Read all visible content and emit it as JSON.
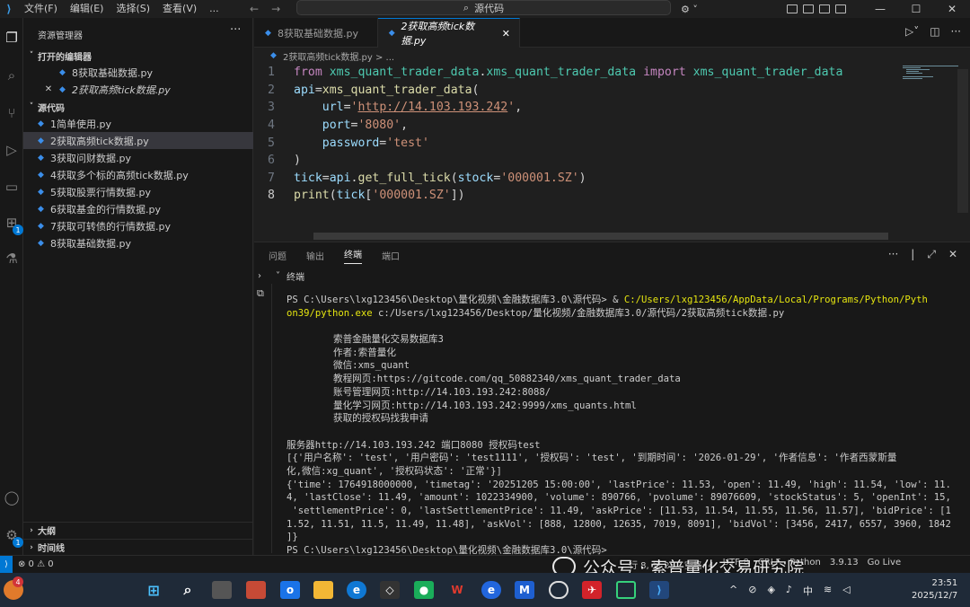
{
  "menu": {
    "items": [
      "文件(F)",
      "编辑(E)",
      "选择(S)",
      "查看(V)",
      "..."
    ]
  },
  "search": {
    "label": "源代码"
  },
  "sidebar": {
    "title": "资源管理器",
    "open_editors_title": "打开的编辑器",
    "open_editors": [
      "8获取基础数据.py",
      "2获取高频tick数据.py"
    ],
    "folder_title": "源代码",
    "files": [
      "1简单使用.py",
      "2获取高频tick数据.py",
      "3获取问财数据.py",
      "4获取多个标的高频tick数据.py",
      "5获取股票行情数据.py",
      "6获取基金的行情数据.py",
      "7获取可转债的行情数据.py",
      "8获取基础数据.py"
    ],
    "outline": "大纲",
    "timeline": "时间线",
    "activity_badge": "1",
    "settings_badge": "1"
  },
  "tabs": [
    {
      "label": "8获取基础数据.py"
    },
    {
      "label": "2获取高频tick数据.py"
    }
  ],
  "breadcrumb": "2获取高频tick数据.py > ...",
  "editor": {
    "line_numbers": [
      "1",
      "2",
      "3",
      "4",
      "5",
      "6",
      "7",
      "8"
    ],
    "lines": [
      [
        [
          "kw",
          "from "
        ],
        [
          "mod",
          "xms_quant_trader_data"
        ],
        [
          "code",
          "."
        ],
        [
          "mod",
          "xms_quant_trader_data"
        ],
        [
          "kw",
          " import "
        ],
        [
          "mod",
          "xms_quant_trader_data"
        ]
      ],
      [
        [
          "var",
          "api"
        ],
        [
          "code",
          "="
        ],
        [
          "fn",
          "xms_quant_trader_data"
        ],
        [
          "code",
          "("
        ]
      ],
      [
        [
          "code",
          "    "
        ],
        [
          "var",
          "url"
        ],
        [
          "code",
          "="
        ],
        [
          "str",
          "'"
        ],
        [
          "url",
          "http://14.103.193.242"
        ],
        [
          "str",
          "'"
        ],
        [
          "code",
          ","
        ]
      ],
      [
        [
          "code",
          "    "
        ],
        [
          "var",
          "port"
        ],
        [
          "code",
          "="
        ],
        [
          "str",
          "'8080'"
        ],
        [
          "code",
          ","
        ]
      ],
      [
        [
          "code",
          "    "
        ],
        [
          "var",
          "password"
        ],
        [
          "code",
          "="
        ],
        [
          "str",
          "'test'"
        ]
      ],
      [
        [
          "code",
          ")"
        ]
      ],
      [
        [
          "var",
          "tick"
        ],
        [
          "code",
          "="
        ],
        [
          "var",
          "api"
        ],
        [
          "code",
          "."
        ],
        [
          "fn",
          "get_full_tick"
        ],
        [
          "code",
          "("
        ],
        [
          "var",
          "stock"
        ],
        [
          "code",
          "="
        ],
        [
          "str",
          "'000001.SZ'"
        ],
        [
          "code",
          ")"
        ]
      ],
      [
        [
          "fn",
          "print"
        ],
        [
          "code",
          "("
        ],
        [
          "var",
          "tick"
        ],
        [
          "code",
          "["
        ],
        [
          "str",
          "'000001.SZ'"
        ],
        [
          "code",
          "])"
        ]
      ]
    ]
  },
  "panel": {
    "tabs": [
      "问题",
      "输出",
      "终端",
      "端口"
    ],
    "terminal_label": "终端",
    "lines": [
      {
        "t": "PS C:\\Users\\lxg123456\\Desktop\\量化视频\\金融数据库3.0\\源代码> & ",
        "y": "C:/Users/lxg123456/AppData/Local/Programs/Python/Pyth"
      },
      {
        "t": "",
        "y": "on39/python.exe",
        "t2": " c:/Users/lxg123456/Desktop/量化视频/金融数据库3.0/源代码/2获取高频tick数据.py"
      },
      {
        "t": ""
      },
      {
        "t": "索普金融量化交易数据库3",
        "i": true
      },
      {
        "t": "作者:索普量化",
        "i": true
      },
      {
        "t": "微信:xms_quant",
        "i": true
      },
      {
        "t": "教程网页:https://gitcode.com/qq_50882340/xms_quant_trader_data",
        "i": true
      },
      {
        "t": "账号管理网页:http://14.103.193.242:8088/",
        "i": true
      },
      {
        "t": "量化学习网页:http://14.103.193.242:9999/xms_quants.html",
        "i": true
      },
      {
        "t": "获取的授权码找我申请",
        "i": true
      },
      {
        "t": ""
      },
      {
        "t": "服务器http://14.103.193.242 端口8080 授权码test"
      },
      {
        "t": "[{'用户名称': 'test', '用户密码': 'test1111', '授权码': 'test', '到期时间': '2026-01-29', '作者信息': '作者西蒙斯量"
      },
      {
        "t": "化,微信:xg_quant', '授权码状态': '正常'}]"
      },
      {
        "t": "{'time': 1764918000000, 'timetag': '20251205 15:00:00', 'lastPrice': 11.53, 'open': 11.49, 'high': 11.54, 'low': 11."
      },
      {
        "t": "4, 'lastClose': 11.49, 'amount': 1022334900, 'volume': 890766, 'pvolume': 89076609, 'stockStatus': 5, 'openInt': 15,"
      },
      {
        "t": " 'settlementPrice': 0, 'lastSettlementPrice': 11.49, 'askPrice': [11.53, 11.54, 11.55, 11.56, 11.57], 'bidPrice': [1"
      },
      {
        "t": "1.52, 11.51, 11.5, 11.49, 11.48], 'askVol': [888, 12800, 12635, 7019, 8091], 'bidVol': [3456, 2417, 6557, 3960, 1842"
      },
      {
        "t": "]}"
      },
      {
        "t": "PS C:\\Users\\lxg123456\\Desktop\\量化视频\\金融数据库3.0\\源代码>"
      }
    ]
  },
  "statusbar": {
    "errors": "⊗ 0 ⚠ 0",
    "items": [
      "行 8, 列 25",
      "空格: 4",
      "UTF-8",
      "CRLF",
      "Python",
      "3.9.13",
      "Go Live"
    ]
  },
  "watermark": "公众号 · 索普量化交易研究院",
  "taskbar": {
    "weather_badge": "4",
    "tray": [
      "^",
      "中"
    ],
    "time": "23:51",
    "date": "2025/12/7"
  }
}
